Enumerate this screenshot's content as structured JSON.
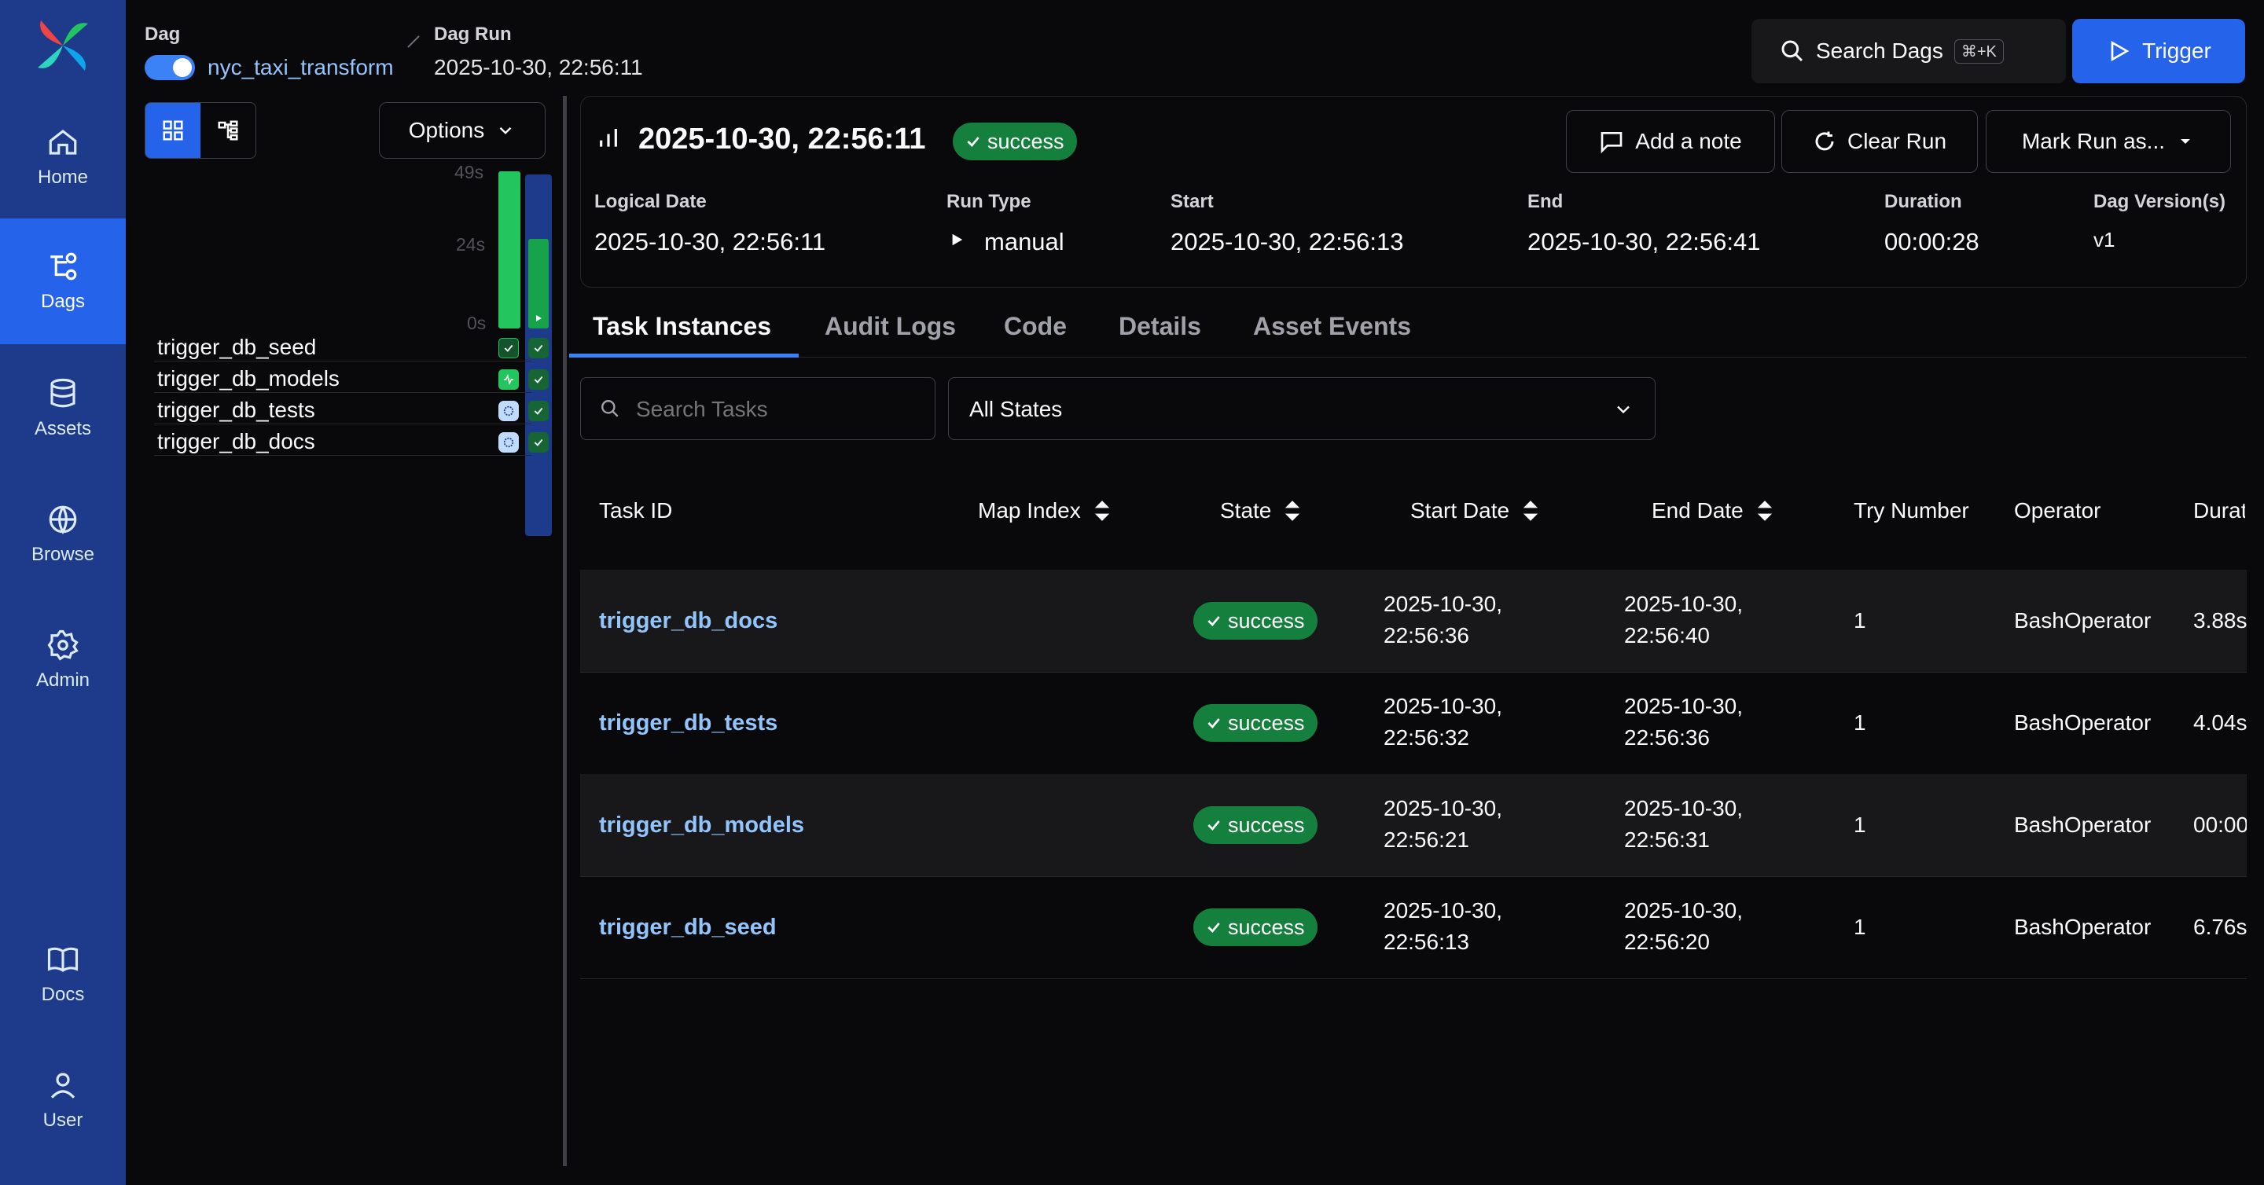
{
  "sidebar": {
    "items": [
      {
        "label": "Home",
        "icon": "home-icon"
      },
      {
        "label": "Dags",
        "icon": "dags-icon",
        "active": true
      },
      {
        "label": "Assets",
        "icon": "database-icon"
      },
      {
        "label": "Browse",
        "icon": "globe-icon"
      },
      {
        "label": "Admin",
        "icon": "gear-icon"
      },
      {
        "label": "Docs",
        "icon": "book-icon"
      },
      {
        "label": "User",
        "icon": "user-icon"
      }
    ]
  },
  "header": {
    "dag_label": "Dag",
    "dag_name": "nyc_taxi_transform",
    "dag_run_label": "Dag Run",
    "dag_run_value": "2025-10-30, 22:56:11",
    "search_label": "Search Dags",
    "search_shortcut": "⌘+K",
    "trigger_label": "Trigger"
  },
  "left_panel": {
    "options_label": "Options",
    "axis": [
      "49s",
      "24s",
      "0s"
    ],
    "tasks": [
      "trigger_db_seed",
      "trigger_db_models",
      "trigger_db_tests",
      "trigger_db_docs"
    ]
  },
  "run": {
    "title": "2025-10-30, 22:56:11",
    "status": "success",
    "add_note": "Add a note",
    "clear_run": "Clear Run",
    "mark_run": "Mark Run as...",
    "meta": {
      "logical_date_label": "Logical Date",
      "logical_date": "2025-10-30, 22:56:11",
      "run_type_label": "Run Type",
      "run_type": "manual",
      "start_label": "Start",
      "start": "2025-10-30, 22:56:13",
      "end_label": "End",
      "end": "2025-10-30, 22:56:41",
      "duration_label": "Duration",
      "duration": "00:00:28",
      "version_label": "Dag Version(s)",
      "version": "v1"
    }
  },
  "tabs": [
    "Task Instances",
    "Audit Logs",
    "Code",
    "Details",
    "Asset Events"
  ],
  "filters": {
    "search_placeholder": "Search Tasks",
    "state_select": "All States"
  },
  "table": {
    "headers": {
      "task_id": "Task ID",
      "map_index": "Map Index",
      "state": "State",
      "start_date": "Start Date",
      "end_date": "End Date",
      "try_number": "Try Number",
      "operator": "Operator",
      "duration": "Durat"
    },
    "rows": [
      {
        "task_id": "trigger_db_docs",
        "state": "success",
        "start_date": "2025-10-30,",
        "start_time": "22:56:36",
        "end_date": "2025-10-30,",
        "end_time": "22:56:40",
        "try_number": "1",
        "operator": "BashOperator",
        "duration": "3.88s"
      },
      {
        "task_id": "trigger_db_tests",
        "state": "success",
        "start_date": "2025-10-30,",
        "start_time": "22:56:32",
        "end_date": "2025-10-30,",
        "end_time": "22:56:36",
        "try_number": "1",
        "operator": "BashOperator",
        "duration": "4.04s"
      },
      {
        "task_id": "trigger_db_models",
        "state": "success",
        "start_date": "2025-10-30,",
        "start_time": "22:56:21",
        "end_date": "2025-10-30,",
        "end_time": "22:56:31",
        "try_number": "1",
        "operator": "BashOperator",
        "duration": "00:00"
      },
      {
        "task_id": "trigger_db_seed",
        "state": "success",
        "start_date": "2025-10-30,",
        "start_time": "22:56:13",
        "end_date": "2025-10-30,",
        "end_time": "22:56:20",
        "try_number": "1",
        "operator": "BashOperator",
        "duration": "6.76s"
      }
    ]
  }
}
